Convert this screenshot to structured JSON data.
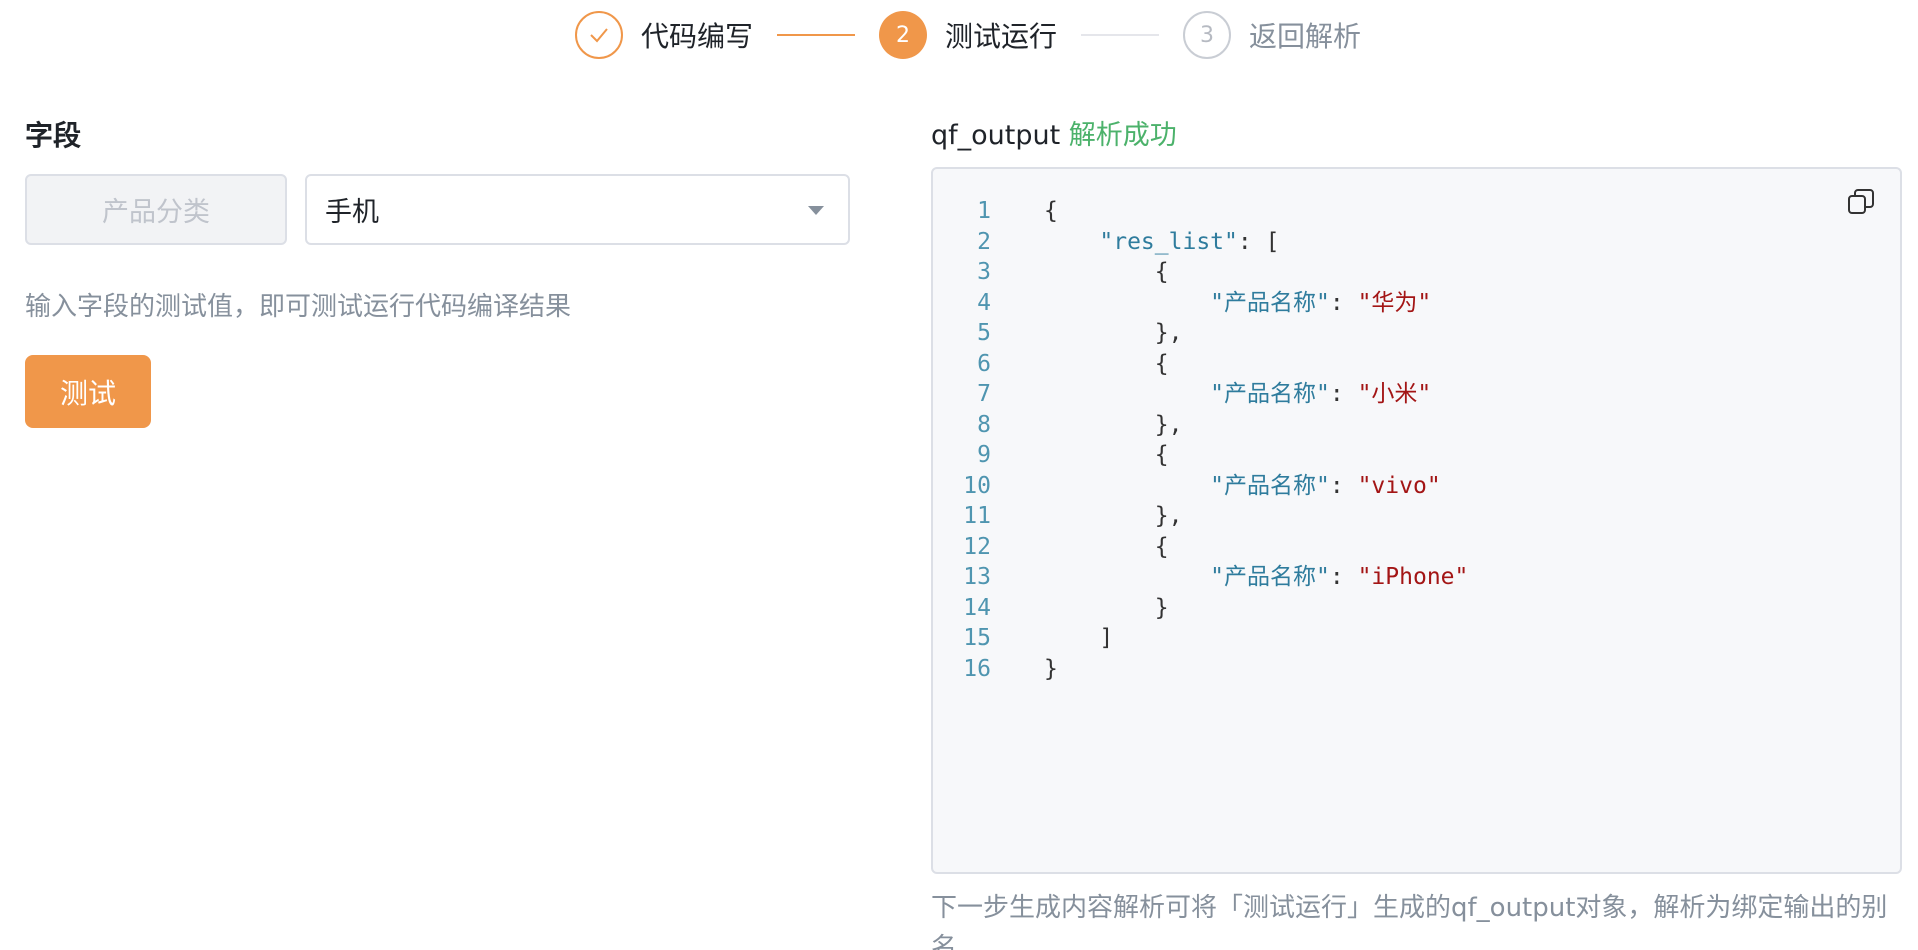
{
  "stepper": {
    "steps": [
      {
        "number": "",
        "label": "代码编写",
        "state": "done",
        "icon": "check-icon"
      },
      {
        "number": "2",
        "label": "测试运行",
        "state": "active"
      },
      {
        "number": "3",
        "label": "返回解析",
        "state": "pending"
      }
    ]
  },
  "fields": {
    "title": "字段",
    "key_placeholder": "产品分类",
    "selected_value": "手机",
    "hint": "输入字段的测试值，即可测试运行代码编译结果",
    "test_button": "测试"
  },
  "output": {
    "name": "qf_output",
    "status": "解析成功",
    "copy_icon": "copy-icon",
    "lines": [
      [
        {
          "t": "{",
          "c": "punc"
        }
      ],
      [
        {
          "t": "    ",
          "c": "punc"
        },
        {
          "t": "\"res_list\"",
          "c": "key"
        },
        {
          "t": ": [",
          "c": "punc"
        }
      ],
      [
        {
          "t": "        {",
          "c": "punc"
        }
      ],
      [
        {
          "t": "            ",
          "c": "punc"
        },
        {
          "t": "\"产品名称\"",
          "c": "key"
        },
        {
          "t": ": ",
          "c": "punc"
        },
        {
          "t": "\"华为\"",
          "c": "str"
        }
      ],
      [
        {
          "t": "        },",
          "c": "punc"
        }
      ],
      [
        {
          "t": "        {",
          "c": "punc"
        }
      ],
      [
        {
          "t": "            ",
          "c": "punc"
        },
        {
          "t": "\"产品名称\"",
          "c": "key"
        },
        {
          "t": ": ",
          "c": "punc"
        },
        {
          "t": "\"小米\"",
          "c": "str"
        }
      ],
      [
        {
          "t": "        },",
          "c": "punc"
        }
      ],
      [
        {
          "t": "        {",
          "c": "punc"
        }
      ],
      [
        {
          "t": "            ",
          "c": "punc"
        },
        {
          "t": "\"产品名称\"",
          "c": "key"
        },
        {
          "t": ": ",
          "c": "punc"
        },
        {
          "t": "\"vivo\"",
          "c": "str"
        }
      ],
      [
        {
          "t": "        },",
          "c": "punc"
        }
      ],
      [
        {
          "t": "        {",
          "c": "punc"
        }
      ],
      [
        {
          "t": "            ",
          "c": "punc"
        },
        {
          "t": "\"产品名称\"",
          "c": "key"
        },
        {
          "t": ": ",
          "c": "punc"
        },
        {
          "t": "\"iPhone\"",
          "c": "str"
        }
      ],
      [
        {
          "t": "        }",
          "c": "punc"
        }
      ],
      [
        {
          "t": "    ]",
          "c": "punc"
        }
      ],
      [
        {
          "t": "}",
          "c": "punc"
        }
      ]
    ],
    "footnote": "下一步生成内容解析可将「测试运行」生成的qf_output对象，解析为绑定输出的别名"
  },
  "colors": {
    "accent": "#f0974a",
    "success": "#4cb26b",
    "muted": "#86909c"
  }
}
